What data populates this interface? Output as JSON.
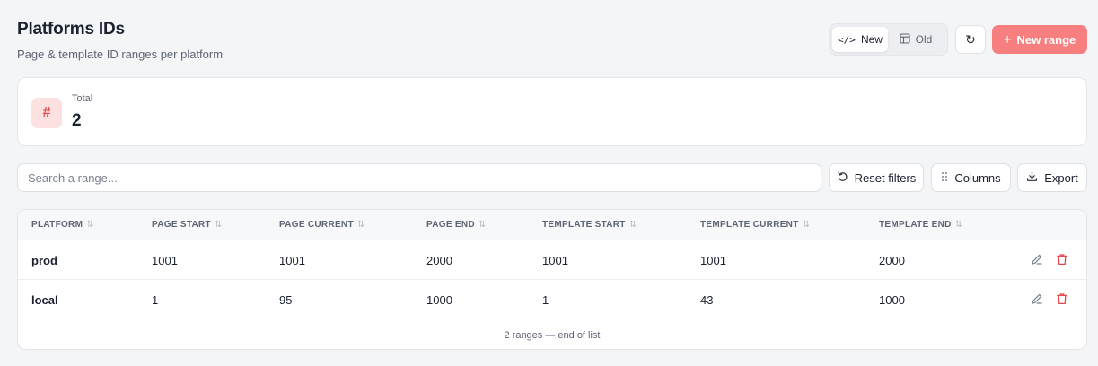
{
  "header": {
    "title": "Platforms IDs",
    "subtitle": "Page & template ID ranges per platform"
  },
  "view_toggle": {
    "options": [
      {
        "label": "New",
        "icon": "code-icon",
        "active": true
      },
      {
        "label": "Old",
        "icon": "layout-icon",
        "active": false
      }
    ]
  },
  "toolbar": {
    "refresh_icon": "↻",
    "new_range_label": "New range",
    "new_range_icon": "+"
  },
  "stats": {
    "icon_glyph": "#",
    "label": "Total",
    "value": "2"
  },
  "filters": {
    "search_placeholder": "Search a range...",
    "reset_label": "Reset filters",
    "columns_label": "Columns",
    "export_label": "Export"
  },
  "table": {
    "columns": [
      "PLATFORM",
      "PAGE START",
      "PAGE CURRENT",
      "PAGE END",
      "TEMPLATE START",
      "TEMPLATE CURRENT",
      "TEMPLATE END"
    ],
    "rows": [
      [
        "prod",
        "1001",
        "1001",
        "2000",
        "1001",
        "1001",
        "2000"
      ],
      [
        "local",
        "1",
        "95",
        "1000",
        "1",
        "43",
        "1000"
      ]
    ],
    "footer": "2 ranges — end of list"
  },
  "colors": {
    "accent": "#f87f7f",
    "danger": "#e5484d",
    "stat_icon_bg": "#fde0e0"
  }
}
